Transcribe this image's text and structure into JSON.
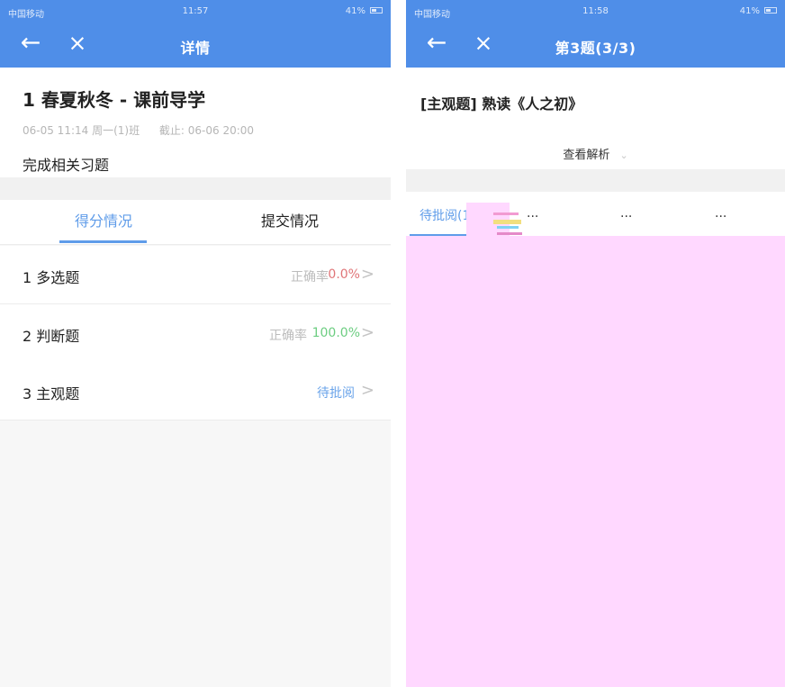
{
  "left": {
    "status": {
      "carrier": "中国移动",
      "time": "11:57",
      "battery": "41%"
    },
    "title": "详情",
    "assignment": {
      "name": "1 春夏秋冬 - 课前导学",
      "meta": "06-05 11:14 周一(1)班",
      "deadline": "截止: 06-06 20:00",
      "description": "完成相关习题"
    },
    "tabs": {
      "score": "得分情况",
      "submit": "提交情况"
    },
    "rows": [
      {
        "label": "1 多选题",
        "rate_label": "正确率",
        "rate_value": "0.0%",
        "chevron": ">"
      },
      {
        "label": "2 判断题",
        "rate_label": "正确率",
        "rate_value": "100.0%",
        "chevron": ">"
      },
      {
        "label": "3 主观题",
        "pending": "待批阅",
        "chevron": ">"
      }
    ]
  },
  "right": {
    "status": {
      "carrier": "中国移动",
      "time": "11:58",
      "battery": "41%"
    },
    "title": "第3题(3/3)",
    "question": "[主观题] 熟读《人之初》",
    "analysis": "查看解析",
    "caret": "⌄",
    "tabs": [
      "待批阅(1)",
      "...",
      "...",
      "..."
    ]
  }
}
